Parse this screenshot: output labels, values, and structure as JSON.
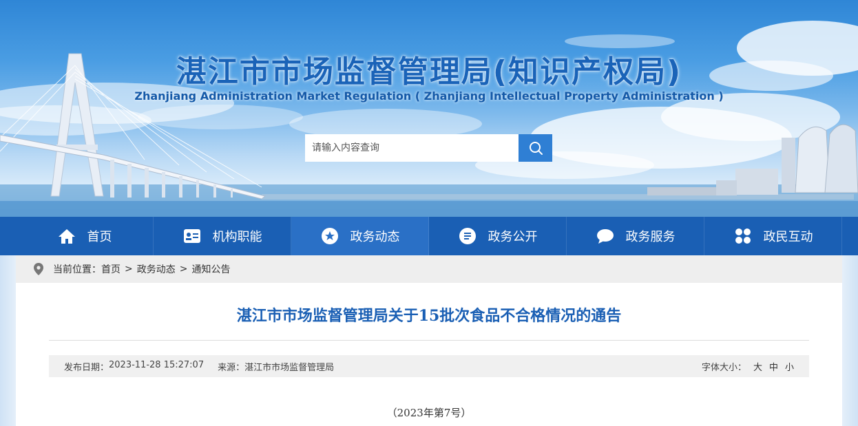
{
  "header": {
    "title": "湛江市市场监督管理局(知识产权局)",
    "subtitle": "Zhanjiang Administration Market Regulation ( Zhanjiang Intellectual Property Administration )"
  },
  "search": {
    "placeholder": "请输入内容查询",
    "value": ""
  },
  "nav": {
    "items": [
      {
        "label": "首页",
        "icon": "home-icon"
      },
      {
        "label": "机构职能",
        "icon": "id-card-icon"
      },
      {
        "label": "政务动态",
        "icon": "star-icon"
      },
      {
        "label": "政务公开",
        "icon": "document-icon"
      },
      {
        "label": "政务服务",
        "icon": "chat-bubble-icon"
      },
      {
        "label": "政民互动",
        "icon": "grid-icon"
      }
    ],
    "active_index": 2
  },
  "breadcrumb": {
    "prefix": "当前位置：",
    "items": [
      "首页",
      "政务动态",
      "通知公告"
    ],
    "separator": ">"
  },
  "article": {
    "title": "湛江市市场监督管理局关于15批次食品不合格情况的通告",
    "publish_label": "发布日期：",
    "publish_date": "2023-11-28 15:27:07",
    "source_label": "来源：",
    "source": "湛江市市场监督管理局",
    "font_size_label": "字体大小：",
    "font_sizes": [
      "大",
      "中",
      "小"
    ],
    "doc_number": "（2023年第7号）"
  },
  "colors": {
    "nav_bg": "#1a5fb4",
    "nav_active": "#2a70c6",
    "title_blue": "#1a5fb4",
    "search_button": "#2f7fd4"
  }
}
